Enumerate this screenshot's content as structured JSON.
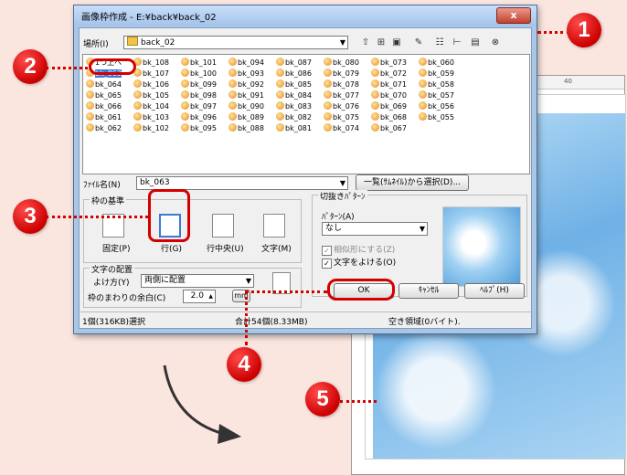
{
  "dialog": {
    "title": "画像枠作成 - E:¥back¥back_02",
    "close": "x",
    "location_label": "場所(I)",
    "location_value": "back_02",
    "file_list": [
      "1つ上へ",
      "bk_063",
      "bk_064",
      "bk_065",
      "bk_066",
      "bk_061",
      "bk_062",
      "bk_108",
      "bk_107",
      "bk_106",
      "bk_105",
      "bk_104",
      "bk_103",
      "bk_102",
      "bk_101",
      "bk_100",
      "bk_099",
      "bk_098",
      "bk_097",
      "bk_096",
      "bk_095",
      "bk_094",
      "bk_093",
      "bk_092",
      "bk_091",
      "bk_090",
      "bk_089",
      "bk_088",
      "bk_087",
      "bk_086",
      "bk_085",
      "bk_084",
      "bk_083",
      "bk_082",
      "bk_081",
      "bk_080",
      "bk_079",
      "bk_078",
      "bk_077",
      "bk_076",
      "bk_075",
      "bk_074",
      "bk_073",
      "bk_072",
      "bk_071",
      "bk_070",
      "bk_069",
      "bk_068",
      "bk_067",
      "bk_060",
      "bk_059",
      "bk_058",
      "bk_057",
      "bk_056",
      "bk_055"
    ],
    "selected_file": "bk_063",
    "filename_label": "ﾌｧｲﾙ名(N)",
    "filename_value": "bk_063",
    "thumbnail_select_button": "一覧(ｻﾑﾈｲﾙ)から選択(D)...",
    "frame_basis": {
      "title": "枠の基準",
      "options": [
        "固定(P)",
        "行(G)",
        "行中央(U)",
        "文字(M)"
      ],
      "selected": "行(G)"
    },
    "crop_pattern": {
      "title": "切抜きﾊﾟﾀｰﾝ",
      "pattern_label": "ﾊﾟﾀｰﾝ(A)",
      "pattern_value": "なし",
      "similar_label": "相似形にする(Z)",
      "avoid_text_label": "文字をよける(O)"
    },
    "text_layout": {
      "title": "文字の配置",
      "wrap_label": "よけ方(Y)",
      "wrap_value": "両側に配置",
      "margin_label": "枠のまわりの余白(C)",
      "margin_value": "2.0",
      "unit": "mm"
    },
    "buttons": {
      "ok": "OK",
      "cancel": "ｷｬﾝｾﾙ",
      "help": "ﾍﾙﾌﾟ(H)"
    },
    "status": {
      "selected": "1個(316KB)選択",
      "total": "合計54個(8.33MB)",
      "free": "空き領域(0バイト)."
    }
  },
  "background_ruler": {
    "mark": "40"
  },
  "callouts": [
    "1",
    "2",
    "3",
    "4",
    "5"
  ],
  "colors": {
    "callout": "#d40000",
    "selection": "#3a7bd5",
    "page_bg": "#fbe6df"
  }
}
